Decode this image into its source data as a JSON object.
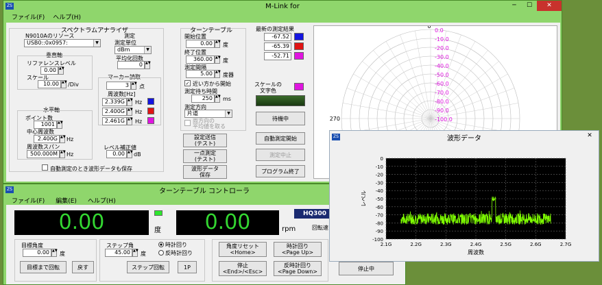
{
  "main": {
    "title": "M-Link for",
    "menu": [
      "ファイル(F)",
      "ヘルプ(H)"
    ],
    "spectrum": {
      "title": "スペクトラムアナライザ",
      "resource_label": "N9010Aのリソース",
      "resource_value": "USB0::0x0957:",
      "measure": "測定",
      "unit_label": "測定単位",
      "unit_value": "dBm",
      "avg_label": "平均化回数",
      "avg_value": "0",
      "vertical": "垂直軸",
      "ref_label": "リファレンスレベル",
      "ref_value": "0.00",
      "scale_label": "スケール",
      "scale_value": "10.00",
      "scale_unit": "/Div",
      "marker_title": "マーカー読取",
      "marker_count": "3",
      "marker_unit": "点",
      "freq_header": "周波数[Hz]",
      "marker_freqs": [
        "2.339G",
        "2.400G",
        "2.461G"
      ],
      "horizontal": "水平軸",
      "points_label": "ポイント数",
      "points_value": "1001",
      "center_label": "中心周波数",
      "center_value": "2.400G",
      "center_unit": "Hz",
      "span_label": "周波数スパン",
      "span_value": "500.000M",
      "span_unit": "Hz",
      "level_label": "レベル補正値",
      "level_value": "0.00",
      "level_unit": "dB",
      "auto_save": "自動測定のとき波形データも保存"
    },
    "turntable": {
      "title": "ターンテーブル",
      "start_label": "開始位置",
      "start_value": "0.00",
      "deg": "度",
      "end_label": "終了位置",
      "end_value": "360.00",
      "interval_label": "測定間隔",
      "interval_value": "5.00",
      "interval_unit": "度器",
      "near_label": "近い方から開始",
      "wait_label": "測定待ち時間",
      "wait_value": "250",
      "wait_unit": "ms",
      "dir_label": "測定方向",
      "dir_value": "片道",
      "avg_both": "両方向の\n平均値を取る",
      "btn_comm": "設定送信\n(テスト)",
      "btn_single": "一点測定\n(テスト)",
      "btn_wave": "波形データ\n保存"
    },
    "results": {
      "title": "最新の測定結果",
      "values": [
        "-67.52",
        "-65.39",
        "-52.71"
      ],
      "scale_color": "スケールの\n文字色",
      "btn_wait": "待機中",
      "btn_auto": "自動測定開始",
      "btn_stop": "測定中止",
      "btn_exit": "プログラム終了"
    },
    "polar": {
      "angle_top": "0",
      "angle_left": "270",
      "rings": [
        "0.0",
        "-10.0",
        "-20.0",
        "-30.0",
        "-40.0",
        "-50.0",
        "-60.0",
        "-70.0",
        "-80.0",
        "-90.0",
        "-100.0"
      ]
    }
  },
  "wave": {
    "title": "波形データ",
    "chart_data": {
      "type": "line",
      "title": "",
      "xlabel": "周波数",
      "ylabel": "レベル",
      "xlim": [
        2.1,
        2.7
      ],
      "ylim": [
        -100,
        0
      ],
      "xticks": [
        "2.1G",
        "2.2G",
        "2.3G",
        "2.4G",
        "2.5G",
        "2.6G",
        "2.7G"
      ],
      "yticks": [
        "0",
        "-10",
        "-20",
        "-30",
        "-40",
        "-50",
        "-60",
        "-70",
        "-80",
        "-90",
        "-100"
      ],
      "noise_floor": -75,
      "noise_x_range": [
        2.15,
        2.65
      ],
      "peak": {
        "x": 2.46,
        "y": -50
      },
      "grid": true
    }
  },
  "tt": {
    "title": "ターンテーブル コントローラ",
    "menu": [
      "ファイル(F)",
      "編集(E)",
      "ヘルプ(H)"
    ],
    "angle_value": "0.00",
    "angle_unit": "度",
    "speed_value": "0.00",
    "speed_unit": "rpm",
    "model": "HQ300",
    "rot_label": "回転速",
    "target_label": "目標角度",
    "target_value": "0.00",
    "target_unit": "度",
    "step_label": "ステップ角",
    "step_value": "45.00",
    "step_unit": "度",
    "cw": "時計回り",
    "ccw": "反時計回り",
    "btn_goto": "目標まで回転",
    "btn_back": "戻す",
    "btn_step": "ステップ回転",
    "btn_1p": "1P",
    "btn_reset": "角度リセット\n<Home>",
    "btn_cw": "時計回り\n<Page Up>",
    "btn_stop": "停止\n<End>/<Esc>",
    "btn_ccw": "反時計回り\n<Page Down>",
    "btn_stopping": "停止中"
  },
  "colors": {
    "m1": "#1414e0",
    "m2": "#e01414",
    "m3": "#e014e0",
    "plot_green": "#7fff00"
  }
}
